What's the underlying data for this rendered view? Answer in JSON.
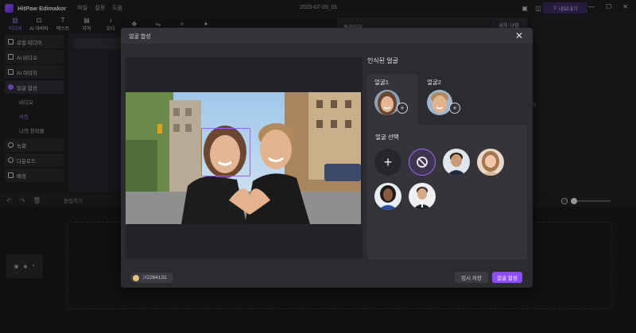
{
  "app": {
    "title": "HitPaw Edimakor",
    "project": "2025-07-29_01"
  },
  "menu": [
    "파일",
    "설정",
    "도움"
  ],
  "export_label": "내보내기",
  "toolbar": [
    {
      "label": "미디어",
      "icon": "media-icon",
      "active": true
    },
    {
      "label": "AI 아바타",
      "icon": "ai-avatar-icon",
      "active": false
    },
    {
      "label": "텍스트",
      "icon": "text-icon",
      "active": false
    },
    {
      "label": "자막",
      "icon": "subtitle-icon",
      "active": false
    },
    {
      "label": "오디",
      "icon": "audio-icon",
      "active": false
    },
    {
      "label": "",
      "icon": "sticker-icon",
      "active": false
    },
    {
      "label": "",
      "icon": "transition-icon",
      "active": false
    },
    {
      "label": "",
      "icon": "effect-icon",
      "active": false
    },
    {
      "label": "",
      "icon": "filter-icon",
      "active": false
    }
  ],
  "sidebar": {
    "items": [
      {
        "label": "로컬 미디어",
        "icon": "folder-icon"
      },
      {
        "label": "AI 비디오",
        "icon": "ai-video-icon"
      },
      {
        "label": "AI 이미지",
        "icon": "ai-image-icon"
      },
      {
        "label": "얼굴 합성",
        "icon": "face-swap-icon"
      }
    ],
    "sub_items": [
      {
        "label": "비디오",
        "active": false
      },
      {
        "label": "사진",
        "active": true
      },
      {
        "label": "나의 창작물",
        "active": false
      }
    ],
    "items_bottom": [
      {
        "label": "녹화",
        "icon": "record-icon"
      },
      {
        "label": "다운로드",
        "icon": "download-icon"
      },
      {
        "label": "배경",
        "icon": "background-icon"
      }
    ]
  },
  "preview_tab": "플레이어",
  "right_tab": "세부 사항",
  "right_text": "기",
  "timeline": {
    "edit_label": "편집하기"
  },
  "modal": {
    "title": "얼굴 합성",
    "recognized_title": "인식된 얼굴",
    "faces": [
      {
        "label": "얼굴1",
        "active": true
      },
      {
        "label": "얼굴2",
        "active": false
      }
    ],
    "select_title": "얼굴 선택",
    "credits": {
      "used": "2",
      "total": "/2264131"
    },
    "save_label": "임시 저장",
    "merge_label": "얼굴 합성"
  },
  "colors": {
    "accent": "#8e4dff",
    "selection": "#a35cff"
  }
}
